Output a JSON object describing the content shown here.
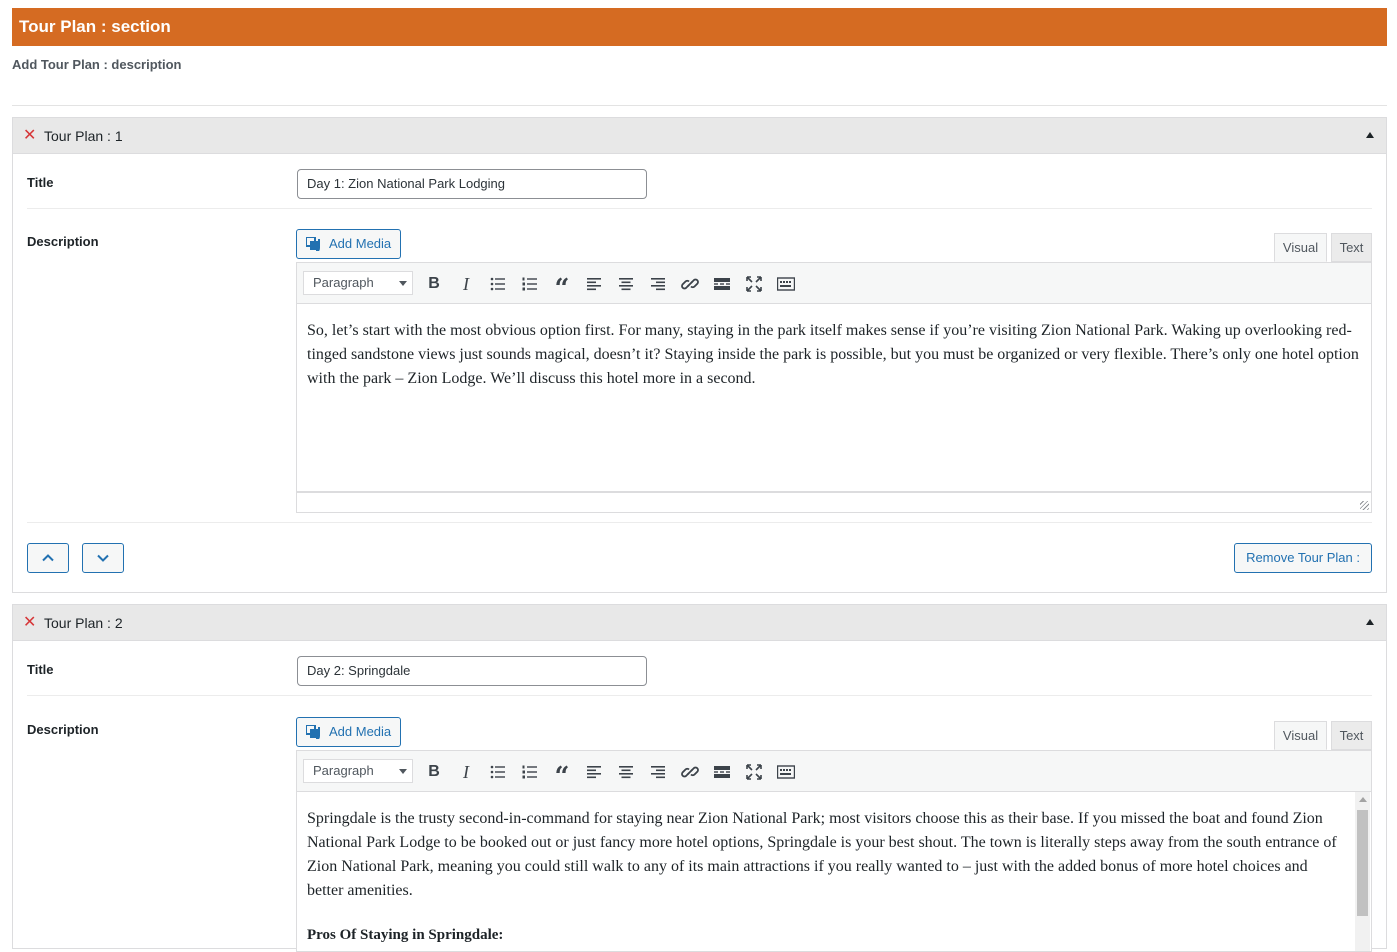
{
  "section": {
    "title": "Tour Plan : section",
    "description": "Add Tour Plan : description"
  },
  "editor_common": {
    "add_media_label": "Add Media",
    "tab_visual": "Visual",
    "tab_text": "Text",
    "format_value": "Paragraph",
    "title_label": "Title",
    "description_label": "Description",
    "remove_label": "Remove Tour Plan :",
    "remove_icon": "x-icon",
    "collapse_icon": "caret-up-icon"
  },
  "plans": [
    {
      "header": "Tour Plan : 1",
      "title_value": "Day 1: Zion National Park Lodging",
      "paragraphs": [
        "So, let’s start with the most obvious option first. For many, staying in the park itself makes sense if you’re visiting Zion National Park. Waking up overlooking red-tinged sandstone views just sounds magical, doesn’t it? Staying inside the park is possible, but you must be organized or very flexible. There’s only one hotel option with the park – Zion Lodge. We’ll discuss this hotel more in a second."
      ]
    },
    {
      "header": "Tour Plan : 2",
      "title_value": "Day 2: Springdale",
      "paragraphs": [
        "Springdale is the trusty second-in-command for staying near Zion National Park; most visitors choose this as their base. If you missed the boat and found Zion National Park Lodge to be booked out or just fancy more hotel options, Springdale is your best shout. The town is literally steps away from the south entrance of Zion National Park, meaning you could still walk to any of its main attractions if you really wanted to – just with the added bonus of more hotel choices and better amenities.",
        "Pros Of Staying in Springdale:"
      ]
    }
  ],
  "colors": {
    "section_header_bg": "#d56b22",
    "accent_blue": "#2271b1",
    "remove_red": "#d63638"
  }
}
